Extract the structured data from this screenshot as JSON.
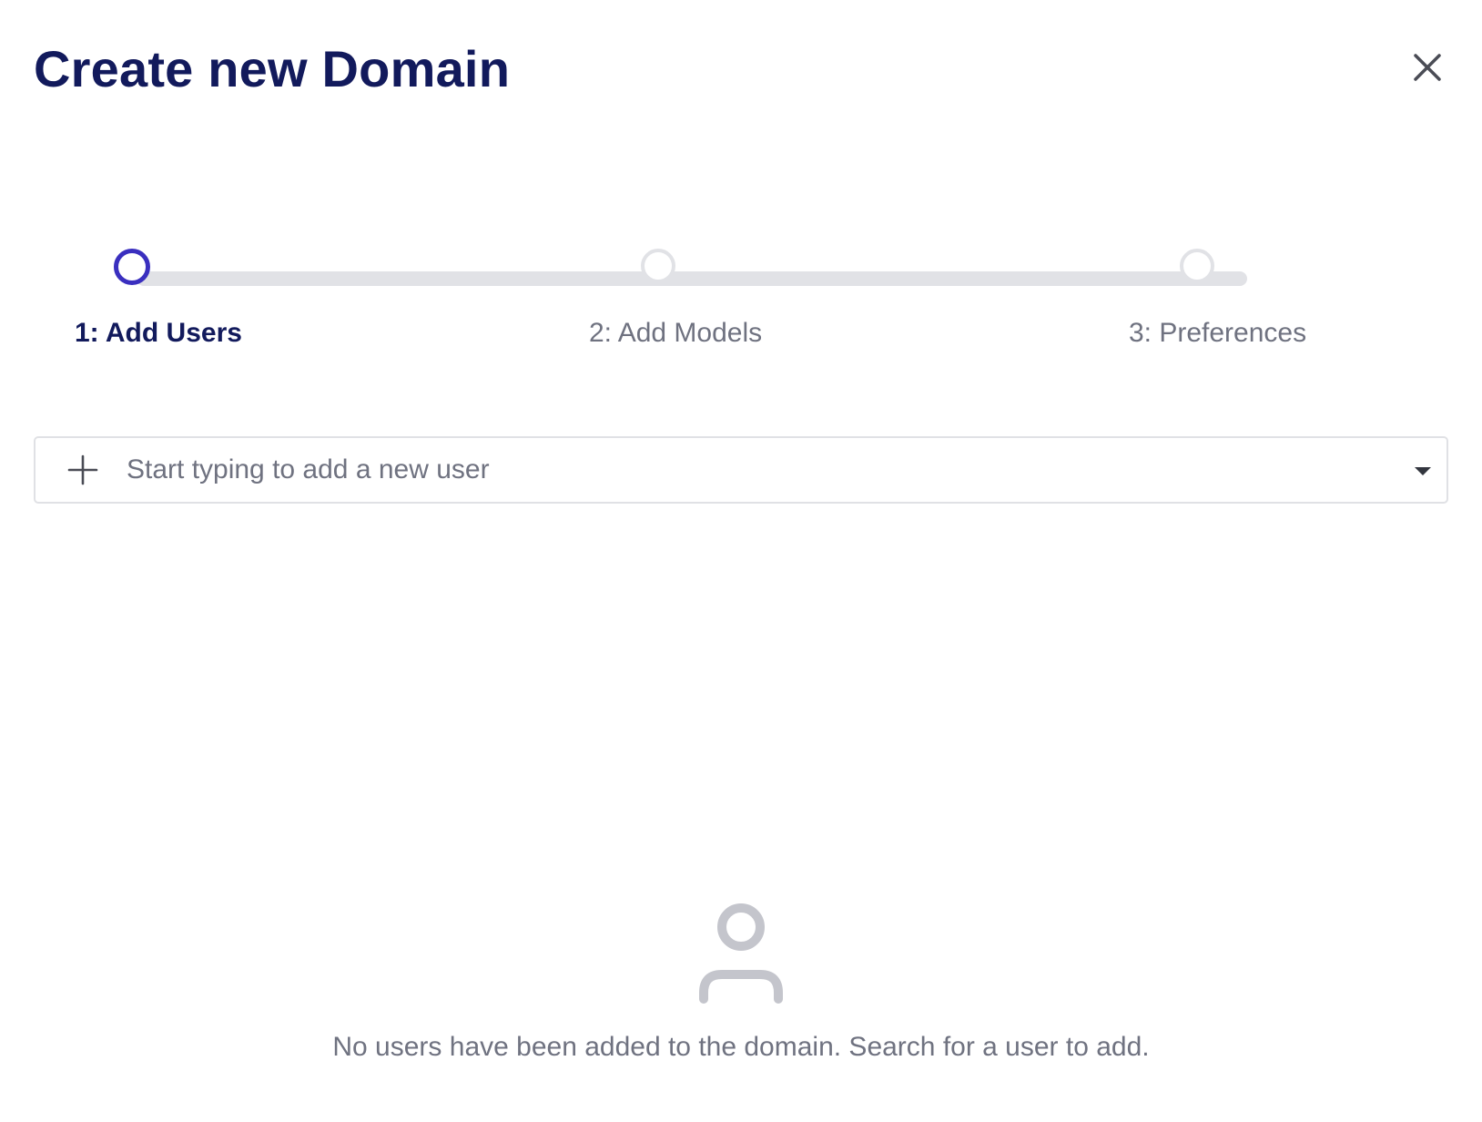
{
  "dialog": {
    "title": "Create new Domain",
    "close_icon": "close-icon"
  },
  "stepper": {
    "steps": [
      {
        "label": "1: Add Users",
        "state": "active"
      },
      {
        "label": "2: Add Models",
        "state": "inactive"
      },
      {
        "label": "3: Preferences",
        "state": "inactive"
      }
    ],
    "active_color": "#3a2fbf",
    "inactive_color": "#e1e2e6"
  },
  "user_search": {
    "placeholder": "Start typing to add a new user",
    "value": "",
    "leading_icon": "plus-icon",
    "trailing_icon": "chevron-down-icon"
  },
  "empty_state": {
    "icon": "user-icon",
    "message": "No users have been added to the domain. Search for a user to add."
  },
  "colors": {
    "title": "#121a5c",
    "muted_text": "#6f7280",
    "icon_gray": "#c4c5cc"
  }
}
